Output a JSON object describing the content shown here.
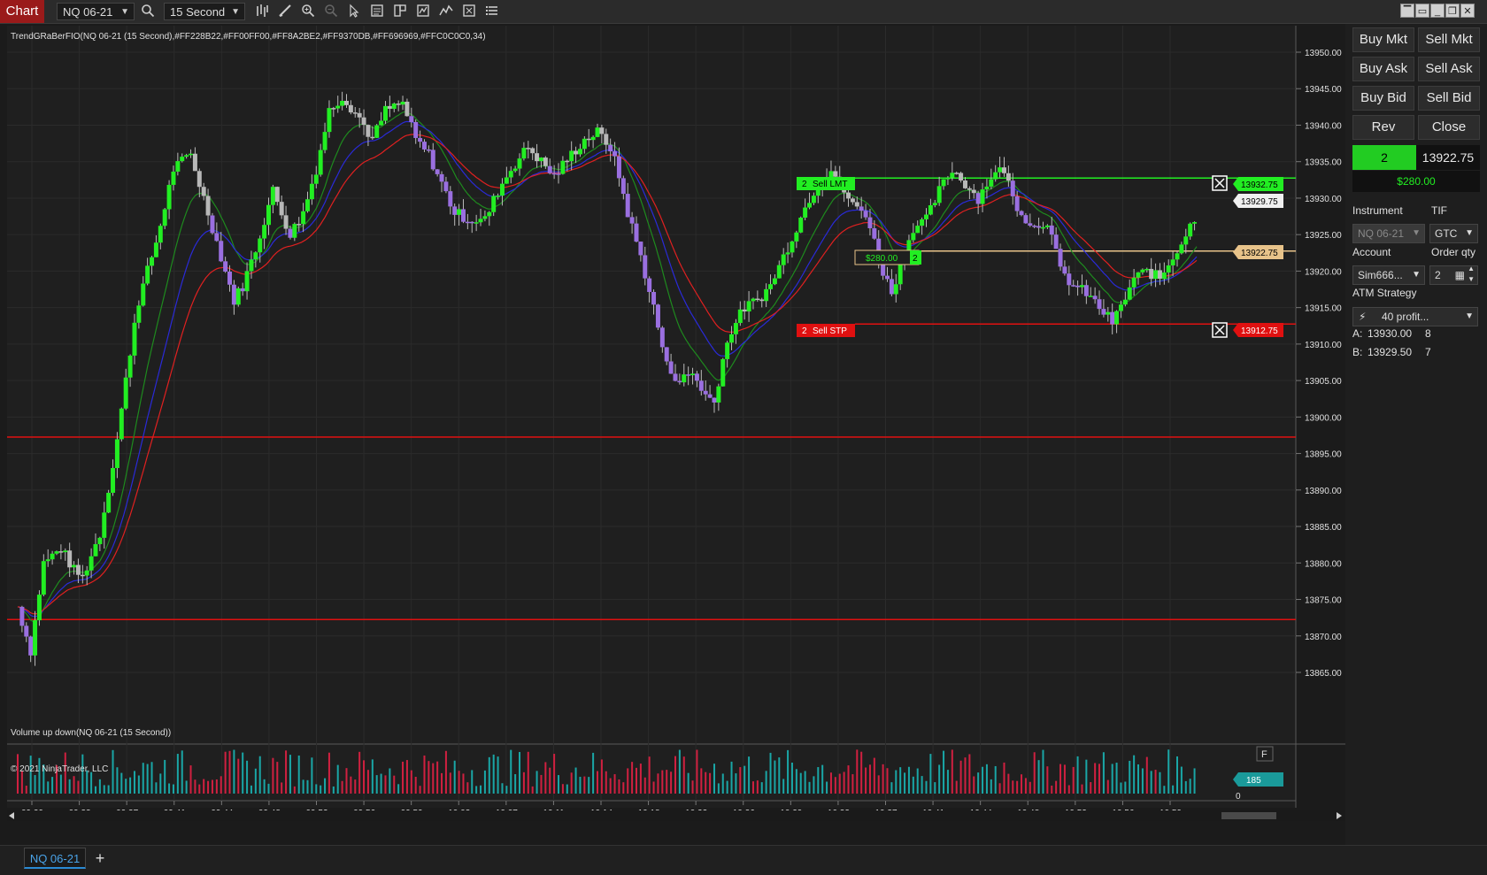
{
  "toolbar": {
    "chart_label": "Chart",
    "instrument": "NQ 06-21",
    "interval": "15 Second",
    "icons": [
      "search-icon",
      "bar-type-icon",
      "draw-icon",
      "zoom-in-icon",
      "zoom-out-icon",
      "pointer-icon",
      "data-box-icon",
      "templates-icon",
      "strategies-icon",
      "indicators-icon",
      "properties-icon",
      "more-icon"
    ],
    "window_buttons": [
      "▔",
      "▭",
      "_",
      "❐",
      "✕"
    ]
  },
  "chart": {
    "indicator_label": "TrendGRaBerFIO(NQ 06-21 (15 Second),#FF228B22,#FF00FF00,#FF8A2BE2,#FF9370DB,#FF696969,#FFC0C0C0,34)",
    "volume_label": "Volume up down(NQ 06-21 (15 Second))",
    "copyright": "© 2021 NinjaTrader, LLC",
    "volume_value": "185",
    "volume_zero": "0",
    "f_button": "F",
    "price_labels": [
      "13950.00",
      "13945.00",
      "13940.00",
      "13935.00",
      "13930.00",
      "13925.00",
      "13920.00",
      "13915.00",
      "13910.00",
      "13905.00",
      "13900.00",
      "13895.00",
      "13890.00",
      "13885.00",
      "13880.00",
      "13875.00",
      "13870.00",
      "13865.00"
    ],
    "time_labels": [
      "09:29",
      "09:33",
      "09:37",
      "09:41",
      "09:44",
      "09:48",
      "09:52",
      "09:56",
      "09:59",
      "10:03",
      "10:07",
      "10:11",
      "10:14",
      "10:18",
      "10:22",
      "10:26",
      "10:29",
      "10:33",
      "10:37",
      "10:41",
      "10:44",
      "10:48",
      "10:52",
      "10:56",
      "10:59"
    ],
    "markers": {
      "sell_lmt_qty": "2",
      "sell_lmt_label": "Sell LMT",
      "sell_lmt_price": "13932.75",
      "current_price": "13929.75",
      "position_pnl": "$280.00",
      "position_qty": "2",
      "entry_price": "13922.75",
      "sell_stp_qty": "2",
      "sell_stp_label": "Sell STP",
      "sell_stp_price": "13912.75"
    },
    "colors": {
      "bull": "#22ee22",
      "bear": "#9a6fe0",
      "neutral": "#b8b8b8",
      "ema_green": "#1e8a1e",
      "ema_blue": "#2a2ad8",
      "ema_red": "#e02020",
      "hline_red": "#e01010"
    }
  },
  "chart_data": {
    "type": "candlestick",
    "instrument": "NQ 06-21",
    "interval": "15 Second",
    "ylim": [
      13863,
      13953
    ],
    "x_range": [
      "09:29",
      "10:59"
    ],
    "close_path": [
      [
        0,
        13874
      ],
      [
        6,
        13868
      ],
      [
        12,
        13880
      ],
      [
        20,
        13882
      ],
      [
        26,
        13879
      ],
      [
        30,
        13878
      ],
      [
        38,
        13884
      ],
      [
        45,
        13895
      ],
      [
        55,
        13915
      ],
      [
        65,
        13925
      ],
      [
        72,
        13934
      ],
      [
        80,
        13936
      ],
      [
        88,
        13928
      ],
      [
        95,
        13921
      ],
      [
        100,
        13916
      ],
      [
        104,
        13918
      ],
      [
        110,
        13923
      ],
      [
        118,
        13931
      ],
      [
        126,
        13925
      ],
      [
        132,
        13928
      ],
      [
        138,
        13934
      ],
      [
        144,
        13942
      ],
      [
        150,
        13944
      ],
      [
        158,
        13941
      ],
      [
        164,
        13938
      ],
      [
        170,
        13942
      ],
      [
        178,
        13943
      ],
      [
        184,
        13938
      ],
      [
        190,
        13936
      ],
      [
        196,
        13932
      ],
      [
        202,
        13928
      ],
      [
        210,
        13927
      ],
      [
        216,
        13927
      ],
      [
        222,
        13931
      ],
      [
        228,
        13934
      ],
      [
        236,
        13937
      ],
      [
        242,
        13935
      ],
      [
        248,
        13933
      ],
      [
        256,
        13936
      ],
      [
        262,
        13938
      ],
      [
        268,
        13939
      ],
      [
        274,
        13937
      ],
      [
        278,
        13933
      ],
      [
        282,
        13928
      ],
      [
        288,
        13922
      ],
      [
        294,
        13915
      ],
      [
        300,
        13907
      ],
      [
        306,
        13905
      ],
      [
        312,
        13906
      ],
      [
        318,
        13903
      ],
      [
        322,
        13902
      ],
      [
        326,
        13908
      ],
      [
        330,
        13912
      ],
      [
        336,
        13915
      ],
      [
        342,
        13916
      ],
      [
        348,
        13918
      ],
      [
        354,
        13922
      ],
      [
        360,
        13926
      ],
      [
        366,
        13930
      ],
      [
        372,
        13933
      ],
      [
        376,
        13934
      ],
      [
        382,
        13931
      ],
      [
        386,
        13929
      ],
      [
        392,
        13928
      ],
      [
        396,
        13924
      ],
      [
        400,
        13920
      ],
      [
        404,
        13917
      ],
      [
        408,
        13921
      ],
      [
        414,
        13926
      ],
      [
        420,
        13927
      ],
      [
        426,
        13931
      ],
      [
        432,
        13934
      ],
      [
        438,
        13932
      ],
      [
        444,
        13930
      ],
      [
        450,
        13933
      ],
      [
        456,
        13934
      ],
      [
        460,
        13930
      ],
      [
        464,
        13928
      ],
      [
        470,
        13926
      ],
      [
        476,
        13927
      ],
      [
        482,
        13920
      ],
      [
        488,
        13918
      ],
      [
        494,
        13917
      ],
      [
        500,
        13915
      ],
      [
        506,
        13913
      ],
      [
        510,
        13915
      ],
      [
        516,
        13919
      ],
      [
        522,
        13920
      ],
      [
        528,
        13919
      ],
      [
        534,
        13922
      ],
      [
        540,
        13925
      ],
      [
        545,
        13928
      ]
    ],
    "total_bars": 546,
    "horizontal_lines": [
      13897.25,
      13872.25,
      13932.75,
      13922.75,
      13912.75
    ],
    "last_price": 13929.75
  },
  "panel": {
    "buttons": [
      [
        "Buy Mkt",
        "Sell Mkt"
      ],
      [
        "Buy Ask",
        "Sell Ask"
      ],
      [
        "Buy Bid",
        "Sell Bid"
      ],
      [
        "Rev",
        "Close"
      ]
    ],
    "position_qty": "2",
    "position_price": "13922.75",
    "position_pnl": "$280.00",
    "instrument_label": "Instrument",
    "tif_label": "TIF",
    "instrument_value": "NQ 06-21",
    "tif_value": "GTC",
    "account_label": "Account",
    "order_qty_label": "Order qty",
    "account_value": "Sim666...",
    "order_qty_value": "2",
    "atm_label": "ATM Strategy",
    "atm_value": "40 profit...",
    "ask_label": "A:",
    "ask_price": "13930.00",
    "ask_size": "8",
    "bid_label": "B:",
    "bid_price": "13929.50",
    "bid_size": "7"
  },
  "tabs": {
    "active": "NQ 06-21",
    "add": "+"
  }
}
